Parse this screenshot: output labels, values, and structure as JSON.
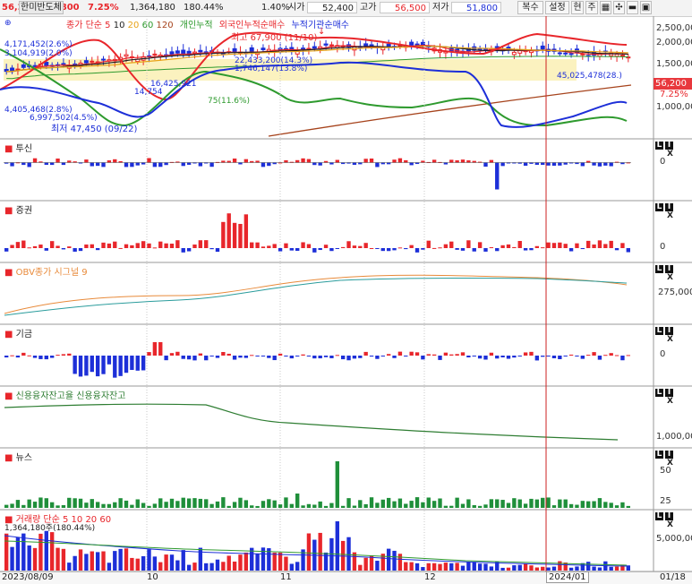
{
  "toolbar": {
    "price": "56,200",
    "change_arrow": "▲",
    "change": "3,800",
    "change_pct": "7.25%",
    "volume": "1,364,180",
    "volume_pct": "180.44%",
    "turnover_pct": "1.40%",
    "open_label": "시가",
    "open": "52,400",
    "high_label": "고가",
    "high": "56,500",
    "low_label": "저가",
    "low": "51,800",
    "buttons": [
      "복수",
      "설정",
      "현",
      "주"
    ],
    "stock_name": "한미반도체"
  },
  "colors": {
    "up": "#e8262b",
    "down": "#1d2fd8",
    "ma5": "#e8262b",
    "ma10": "#222222",
    "ma20": "#e8a317",
    "ma60": "#2e9a2e",
    "ma120": "#a6431c",
    "envelope_band": "#faf0b4",
    "retail_line": "#2e9a2e",
    "foreign_line": "#e8262b",
    "inst_line": "#1d2fd8",
    "obv_line": "#e88a3a",
    "obv_signal": "#2a9c9c",
    "credit_line": "#2e7d32",
    "news_bar": "#1f8f3a",
    "cursor_line": "#cc2222"
  },
  "main_panel": {
    "legend": [
      {
        "text": "종가 단순",
        "color": "#e8262b"
      },
      {
        "text": "5",
        "color": "#e8262b"
      },
      {
        "text": "10",
        "color": "#222222"
      },
      {
        "text": "20",
        "color": "#e8a317"
      },
      {
        "text": "60",
        "color": "#2e9a2e"
      },
      {
        "text": "120",
        "color": "#a6431c"
      },
      {
        "text": "개인누적",
        "color": "#2e9a2e"
      },
      {
        "text": "외국인누적순매수",
        "color": "#e8262b"
      },
      {
        "text": "누적기관순매수",
        "color": "#1d2fd8"
      }
    ],
    "y_axis": [
      "2,500,00",
      "2,000,00",
      "1,500,00",
      "1,000,00"
    ],
    "current_price_label": "56,200",
    "current_pct_label": "7.25%",
    "annotations": {
      "high": "최고 67,900 (11/10)",
      "low": "최저 47,450 (09/22)",
      "a1": "4,171,452(2.6%)",
      "a2": "3,104,919(2.0%)",
      "a3": "4,405,468(2.8%)",
      "a4": "6,997,502(4.5%)",
      "a5": "16,425,921",
      "a6": "14,754",
      "a7": "75(11.6%)",
      "a8": "22,433,200(14.3%)",
      "a9": "1,746,147(13.8%)",
      "a10": "45,025,478(28.)"
    }
  },
  "panels": [
    {
      "id": "fin",
      "title": "투신",
      "title_color": "#333",
      "axis": [
        "0"
      ]
    },
    {
      "id": "sec",
      "title": "증권",
      "title_color": "#333",
      "axis": [
        "0"
      ]
    },
    {
      "id": "obv",
      "title": "OBV종가  시그널 9",
      "title_color": "#e88a3a",
      "axis": [
        "275,000,"
      ]
    },
    {
      "id": "fund",
      "title": "기금",
      "title_color": "#333",
      "axis": [
        "0"
      ]
    },
    {
      "id": "credit",
      "title": "신용융자잔고율    신용융자잔고",
      "title_color": "#2e7d32",
      "axis": [
        "1,000,00"
      ]
    },
    {
      "id": "news",
      "title": "뉴스",
      "title_color": "#333",
      "axis": [
        "50",
        "25"
      ]
    },
    {
      "id": "vol",
      "title": "거래량  단순  5  10  20  60",
      "title_color": "#e8262b",
      "axis": [
        "5,000,00"
      ]
    }
  ],
  "volume_label": "1,364,180주(180.44%)",
  "panel_buttons": [
    "L",
    "I",
    "X"
  ],
  "dates": [
    "2023/08/09",
    "10",
    "11",
    "12",
    "2024/01",
    "01/18"
  ]
}
